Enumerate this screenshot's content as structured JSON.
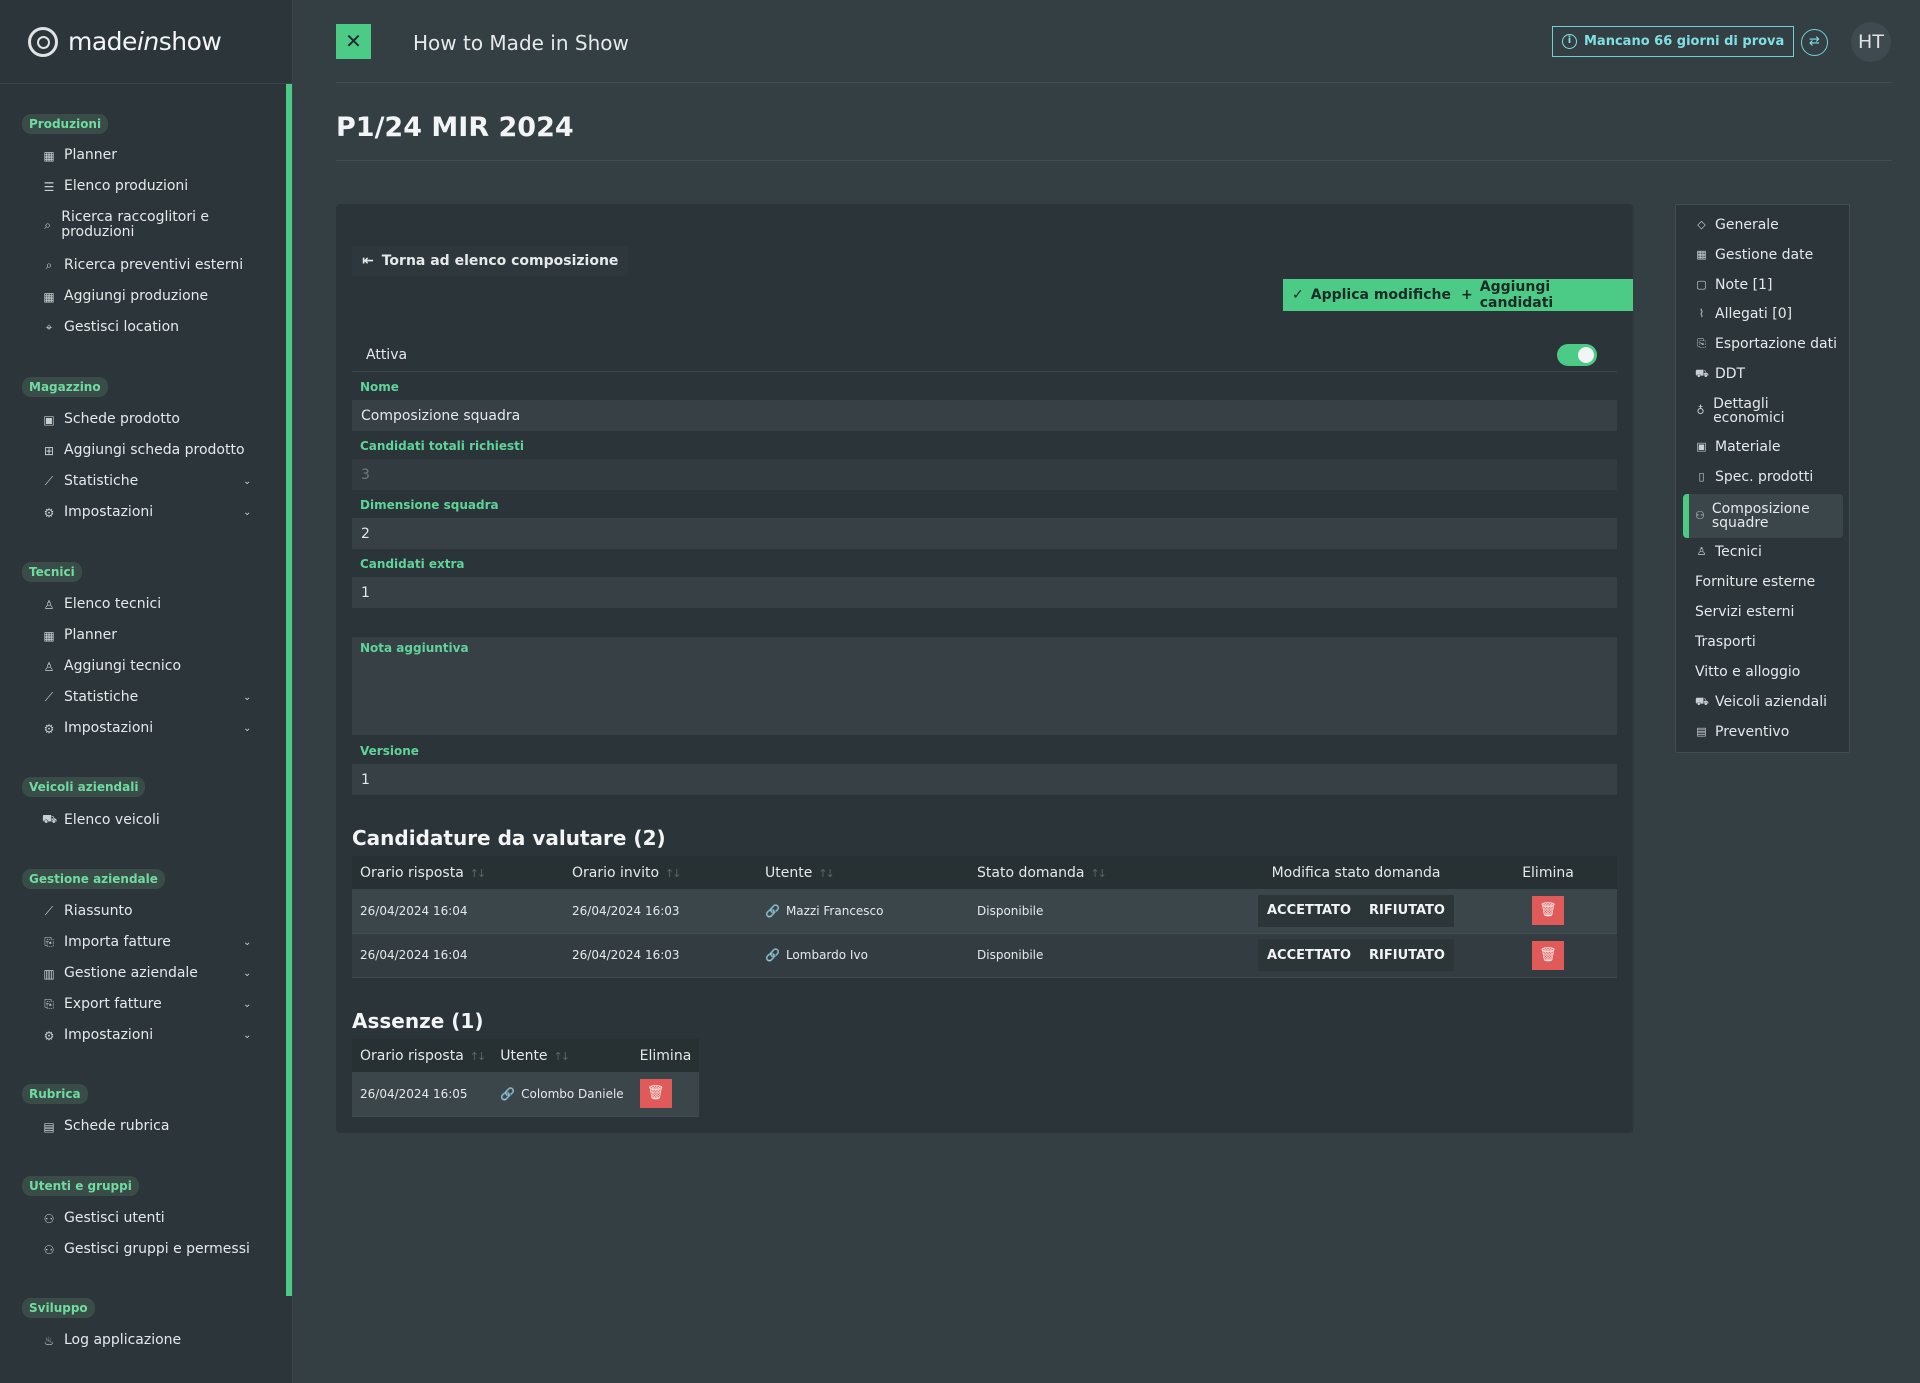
{
  "brand": {
    "part1": "made",
    "part2": "in",
    "part3": "show"
  },
  "sidebar": {
    "sections": [
      {
        "title": "Produzioni",
        "items": [
          {
            "label": "Planner",
            "icon": "calendar-icon"
          },
          {
            "label": "Elenco produzioni",
            "icon": "list-icon"
          },
          {
            "label": "Ricerca raccoglitori e produzioni",
            "icon": "search-icon"
          },
          {
            "label": "Ricerca preventivi esterni",
            "icon": "search-icon"
          },
          {
            "label": "Aggiungi produzione",
            "icon": "calendar-plus-icon"
          },
          {
            "label": "Gestisci location",
            "icon": "map-pin-icon"
          }
        ]
      },
      {
        "title": "Magazzino",
        "items": [
          {
            "label": "Schede prodotto",
            "icon": "boxes-icon"
          },
          {
            "label": "Aggiungi scheda prodotto",
            "icon": "plus-square-icon"
          },
          {
            "label": "Statistiche",
            "icon": "chart-line-icon"
          },
          {
            "label": "Impostazioni",
            "icon": "gear-icon"
          }
        ]
      },
      {
        "title": "Tecnici",
        "items": [
          {
            "label": "Elenco tecnici",
            "icon": "user-icon"
          },
          {
            "label": "Planner",
            "icon": "calendar-icon"
          },
          {
            "label": "Aggiungi tecnico",
            "icon": "user-plus-icon"
          },
          {
            "label": "Statistiche",
            "icon": "chart-line-icon"
          },
          {
            "label": "Impostazioni",
            "icon": "gear-icon"
          }
        ]
      },
      {
        "title": "Veicoli aziendali",
        "items": [
          {
            "label": "Elenco veicoli",
            "icon": "truck-icon"
          }
        ]
      },
      {
        "title": "Gestione aziendale",
        "items": [
          {
            "label": "Riassunto",
            "icon": "chart-line-icon"
          },
          {
            "label": "Importa fatture",
            "icon": "file-import-icon"
          },
          {
            "label": "Gestione aziendale",
            "icon": "chart-bar-icon"
          },
          {
            "label": "Export fatture",
            "icon": "file-export-icon"
          },
          {
            "label": "Impostazioni",
            "icon": "gear-icon"
          }
        ]
      },
      {
        "title": "Rubrica",
        "items": [
          {
            "label": "Schede rubrica",
            "icon": "address-book-icon"
          }
        ]
      },
      {
        "title": "Utenti e gruppi",
        "items": [
          {
            "label": "Gestisci utenti",
            "icon": "users-icon"
          },
          {
            "label": "Gestisci gruppi e permessi",
            "icon": "users-icon"
          }
        ]
      },
      {
        "title": "Sviluppo",
        "items": [
          {
            "label": "Log applicazione",
            "icon": "fire-icon"
          }
        ]
      }
    ]
  },
  "topbar": {
    "close_glyph": "✕",
    "title": "How to Made in Show",
    "trial_text": "Mancano 66 giorni di prova",
    "avatar_initials": "HT"
  },
  "page": {
    "title": "P1/24 MIR 2024"
  },
  "form": {
    "back_label": "Torna ad elenco composizione",
    "apply_label": "Applica modifiche",
    "add_label": "Aggiungi candidati",
    "active_label": "Attiva",
    "active_on": true,
    "name_label": "Nome",
    "name_value": "Composizione squadra",
    "total_label": "Candidati totali richiesti",
    "total_value": "3",
    "size_label": "Dimensione squadra",
    "size_value": "2",
    "extra_label": "Candidati extra",
    "extra_value": "1",
    "note_label": "Nota aggiuntiva",
    "note_value": "",
    "version_label": "Versione",
    "version_value": "1"
  },
  "applications": {
    "title": "Candidature da valutare (2)",
    "headers": {
      "reply": "Orario risposta",
      "invite": "Orario invito",
      "user": "Utente",
      "state": "Stato domanda",
      "modify": "Modifica stato domanda",
      "delete": "Elimina"
    },
    "accept_label": "ACCETTATO",
    "reject_label": "RIFIUTATO",
    "rows": [
      {
        "reply": "26/04/2024 16:04",
        "invite": "26/04/2024 16:03",
        "user": "Mazzi Francesco",
        "state": "Disponibile"
      },
      {
        "reply": "26/04/2024 16:04",
        "invite": "26/04/2024 16:03",
        "user": "Lombardo Ivo",
        "state": "Disponibile"
      }
    ]
  },
  "absences": {
    "title": "Assenze (1)",
    "headers": {
      "reply": "Orario risposta",
      "user": "Utente",
      "delete": "Elimina"
    },
    "rows": [
      {
        "reply": "26/04/2024 16:05",
        "user": "Colombo Daniele"
      }
    ]
  },
  "right_nav": {
    "items": [
      {
        "label": "Generale",
        "icon": "tag-icon"
      },
      {
        "label": "Gestione date",
        "icon": "calendar-icon"
      },
      {
        "label": "Note [1]",
        "icon": "note-icon"
      },
      {
        "label": "Allegati [0]",
        "icon": "paperclip-icon"
      },
      {
        "label": "Esportazione dati",
        "icon": "file-export-icon"
      },
      {
        "label": "DDT",
        "icon": "dolly-icon"
      },
      {
        "label": "Dettagli economici",
        "icon": "money-bag-icon"
      },
      {
        "label": "Materiale",
        "icon": "boxes-icon"
      },
      {
        "label": "Spec. prodotti",
        "icon": "file-icon"
      },
      {
        "label": "Composizione squadre",
        "icon": "users-icon"
      },
      {
        "label": "Tecnici",
        "icon": "user-icon"
      },
      {
        "label": "Forniture esterne",
        "icon": ""
      },
      {
        "label": "Servizi esterni",
        "icon": ""
      },
      {
        "label": "Trasporti",
        "icon": ""
      },
      {
        "label": "Vitto e alloggio",
        "icon": ""
      },
      {
        "label": "Veicoli aziendali",
        "icon": "truck-icon"
      },
      {
        "label": "Preventivo",
        "icon": "file-invoice-icon"
      }
    ],
    "active_index": 9
  },
  "colors": {
    "accent": "#4ccb86",
    "danger": "#e05a5a",
    "info": "#7ee0e4",
    "background": "#343f44"
  }
}
